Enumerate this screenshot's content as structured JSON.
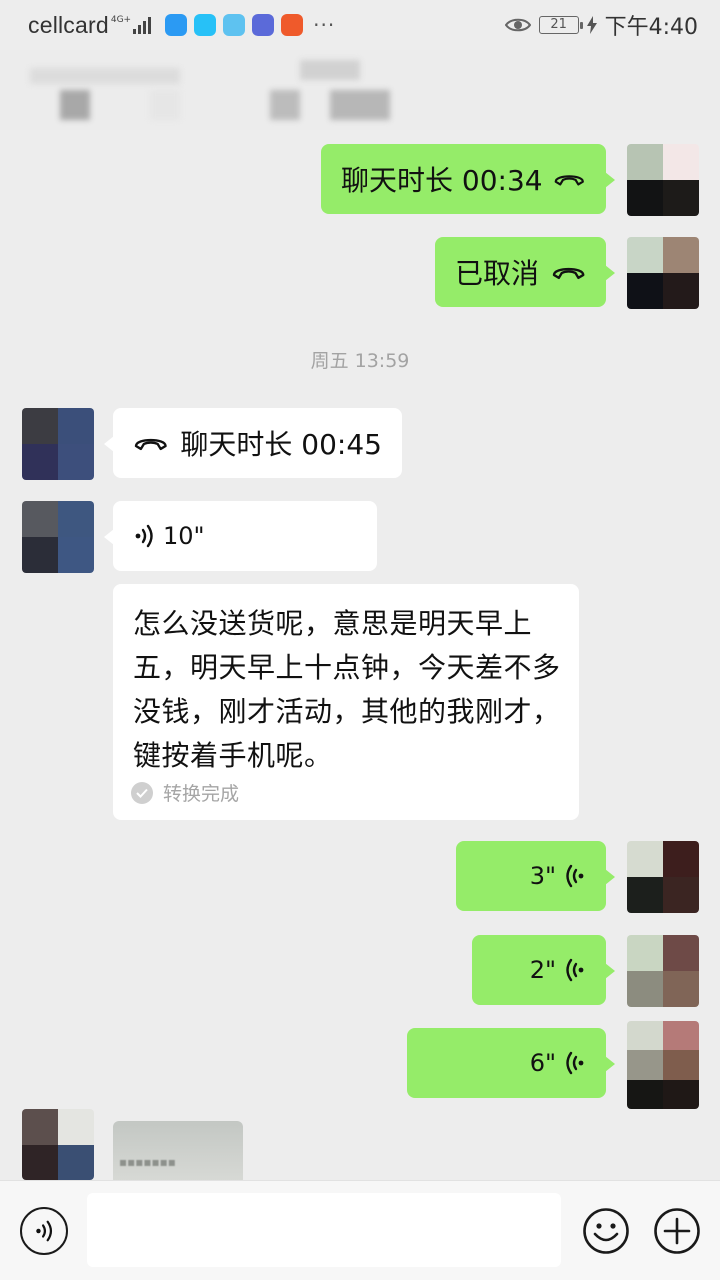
{
  "status_bar": {
    "carrier": "cellcard",
    "network": "4G+",
    "battery": "21",
    "time": "下午4:40"
  },
  "messages": {
    "sent_call_duration": {
      "label": "聊天时长 00:34",
      "icon": "phone-hangup-icon"
    },
    "sent_call_cancelled": {
      "label": "已取消",
      "icon": "phone-hangup-icon"
    },
    "timestamp": "周五 13:59",
    "received_call_duration": {
      "label": "聊天时长 00:45",
      "icon": "phone-hangup-icon"
    },
    "received_voice": {
      "duration": "10\"",
      "icon": "voice-wave-icon"
    },
    "transcript": {
      "text": "怎么没送货呢，意思是明天早上五，明天早上十点钟，今天差不多没钱，刚才活动，其他的我刚才，键按着手机呢。",
      "status": "转换完成"
    },
    "sent_voice_1": {
      "duration": "3\""
    },
    "sent_voice_2": {
      "duration": "2\""
    },
    "sent_voice_3": {
      "duration": "6\""
    }
  },
  "input_bar": {
    "voice_icon": "voice-mode-icon",
    "emoji_icon": "emoji-icon",
    "plus_icon": "plus-icon",
    "value": ""
  },
  "colors": {
    "sent_bubble": "#95ec69",
    "received_bubble": "#ffffff",
    "background": "#ededed"
  }
}
